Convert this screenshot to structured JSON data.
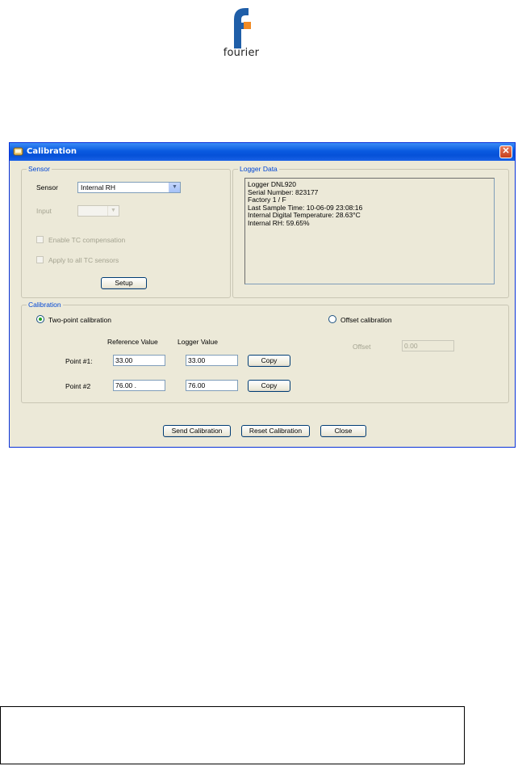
{
  "logo": {
    "text": "fourier",
    "colors": {
      "blue": "#1f5ea8",
      "orange": "#f08a24"
    }
  },
  "window": {
    "title": "Calibration",
    "close_glyph": "✕",
    "sensor_group": {
      "legend": "Sensor",
      "sensor_label": "Sensor",
      "sensor_value": "Internal RH",
      "input_label": "Input",
      "input_value": "",
      "enable_tc_label": "Enable TC compensation",
      "apply_tc_label": "Apply to all TC sensors",
      "setup_button": "Setup"
    },
    "logger_group": {
      "legend": "Logger Data",
      "lines": [
        "Logger DNL920",
        "Serial Number: 823177",
        "Factory 1 / F",
        "Last Sample Time: 10-06-09 23:08:16",
        "Internal Digital Temperature: 28.63°C",
        "Internal RH: 59.65%"
      ]
    },
    "calibration_group": {
      "legend": "Calibration",
      "two_point_label": "Two-point calibration",
      "two_point_selected": true,
      "offset_label": "Offset calibration",
      "offset_selected": false,
      "reference_header": "Reference Value",
      "logger_header": "Logger Value",
      "points": [
        {
          "label": "Point #1:",
          "reference": "33.00",
          "logger": "33.00",
          "copy_button": "Copy"
        },
        {
          "label": "Point #2",
          "reference": "76.00 .",
          "logger": "76.00",
          "copy_button": "Copy"
        }
      ],
      "offset_field_label": "Offset",
      "offset_value": "0.00"
    },
    "buttons": {
      "send": "Send Calibration",
      "reset": "Reset Calibration",
      "close": "Close"
    }
  }
}
